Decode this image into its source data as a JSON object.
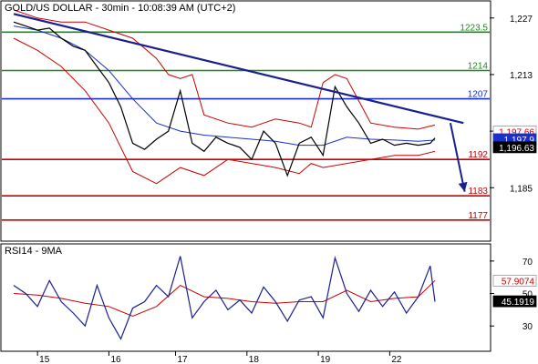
{
  "chart_data": {
    "type": "line",
    "title": "GOLD/US DOLLAR - 30min - 10:08:39 AM (UTC+2)",
    "colors": {
      "price": "#000000",
      "bollinger": "#cc0000",
      "moving_average": "#1a2fcc",
      "trendline": "#1a1f8f",
      "resistance": "#1b8c1b",
      "pivot": "#1a2fcc",
      "support": "#cc0000",
      "rsi": "#1a1f8f",
      "rsi_ma": "#cc0000"
    },
    "x_tick_labels": [
      "15",
      "16",
      "17",
      "18",
      "19",
      "22"
    ],
    "price_panel": {
      "y_ticks": [
        1227,
        1213,
        1199,
        1185
      ],
      "y_tick_labels": [
        "1,227",
        "1,213",
        "",
        "1,185"
      ],
      "ylim": [
        1172,
        1231
      ],
      "levels": [
        {
          "value": 1223.5,
          "label": "1223.5",
          "kind": "resistance"
        },
        {
          "value": 1214,
          "label": "1214",
          "kind": "resistance"
        },
        {
          "value": 1207,
          "label": "1207",
          "kind": "pivot"
        },
        {
          "value": 1192,
          "label": "1192",
          "kind": "support"
        },
        {
          "value": 1183,
          "label": "1183",
          "kind": "support"
        },
        {
          "value": 1177,
          "label": "1177",
          "kind": "support"
        }
      ],
      "price_boxes": [
        {
          "label": "1,197.66",
          "value": 1198.9,
          "style": "red-text"
        },
        {
          "label": "1,197.9",
          "value": 1197.0,
          "style": "blue-fill"
        },
        {
          "label": "1,196.63",
          "value": 1195.0,
          "style": "black-fill"
        }
      ],
      "trendline": {
        "x": [
          0.5,
          19.4
        ],
        "y": [
          1228,
          1201
        ]
      },
      "arrow": {
        "x": [
          18.85,
          19.45
        ],
        "y": [
          1201,
          1184
        ]
      },
      "close_series": {
        "x": [
          0.5,
          1,
          1.5,
          2,
          2.5,
          3,
          3.5,
          4,
          4.5,
          5,
          5.5,
          6,
          6.5,
          7,
          7.5,
          8,
          8.5,
          9,
          9.5,
          10,
          10.5,
          11,
          11.5,
          12,
          12.5,
          13,
          13.5,
          14,
          14.5,
          15,
          15.5,
          16,
          16.5,
          17,
          17.5,
          18,
          18.2
        ],
        "y": [
          1226,
          1225,
          1224,
          1224.5,
          1222,
          1220,
          1219,
          1215,
          1211,
          1205,
          1196,
          1194.5,
          1197,
          1199,
          1209,
          1196,
          1194,
          1197.5,
          1196,
          1195,
          1192,
          1199,
          1196,
          1188,
          1196,
          1197.5,
          1193,
          1210,
          1205,
          1201,
          1196,
          1197,
          1195.5,
          1196,
          1195.5,
          1196,
          1197.3
        ]
      },
      "ma_series": {
        "x": [
          0.5,
          1.5,
          2.5,
          3.5,
          4.5,
          5.5,
          6.5,
          7.5,
          8.5,
          9.5,
          10.5,
          11.5,
          12.5,
          13.5,
          14.5,
          15.5,
          16.5,
          17.5,
          18.2
        ],
        "y": [
          1225,
          1224,
          1222,
          1219,
          1214,
          1207,
          1201,
          1199,
          1198,
          1197.5,
          1197,
          1196.5,
          1195.5,
          1195.5,
          1197.5,
          1197,
          1196.8,
          1196.5,
          1196.8
        ]
      },
      "bollinger_upper": {
        "x": [
          0.5,
          1.5,
          2.5,
          3.5,
          4.5,
          5.5,
          6.5,
          7,
          7.5,
          8,
          8.5,
          9.5,
          10.5,
          11,
          11.5,
          12.5,
          13,
          13.5,
          14,
          14.5,
          15.5,
          16.5,
          17.5,
          18.2
        ],
        "y": [
          1229,
          1227,
          1226,
          1226,
          1224,
          1222,
          1217,
          1213,
          1212,
          1213,
          1203,
          1201,
          1200,
          1201,
          1202,
          1201,
          1200,
          1211,
          1213,
          1212,
          1201,
          1200,
          1199.5,
          1200.5
        ]
      },
      "bollinger_lower": {
        "x": [
          0.5,
          1.5,
          2.5,
          3.5,
          4.5,
          5.5,
          6.5,
          7.5,
          8.5,
          9.5,
          10.5,
          11.5,
          12.5,
          13,
          13.5,
          14.5,
          15.5,
          16.5,
          17.5,
          18.2
        ],
        "y": [
          1222,
          1219,
          1215,
          1209,
          1201,
          1189,
          1186,
          1190,
          1188,
          1192,
          1191,
          1190,
          1188.5,
          1191,
          1190,
          1191,
          1192,
          1193,
          1193,
          1194
        ]
      }
    },
    "rsi_panel": {
      "title": "RSI14 - 9MA",
      "ylim": [
        15,
        80
      ],
      "y_ticks": [
        70,
        50,
        30
      ],
      "y_tick_labels": [
        "70",
        "50",
        "30"
      ],
      "value_boxes": [
        {
          "label": "57.9074",
          "value": 57.9,
          "style": "red-text"
        },
        {
          "label": "45.1919",
          "value": 45.2,
          "style": "black-fill"
        }
      ],
      "rsi_series": {
        "x": [
          0.5,
          1,
          1.5,
          2,
          2.5,
          3,
          3.5,
          4,
          4.5,
          5,
          5.5,
          6,
          6.5,
          7,
          7.5,
          8,
          8.5,
          9,
          9.5,
          10,
          10.5,
          11,
          11.5,
          12,
          12.5,
          13,
          13.5,
          14,
          14.5,
          15,
          15.5,
          16,
          16.5,
          17,
          17.5,
          18,
          18.2
        ],
        "y": [
          55,
          50,
          42,
          58,
          45,
          38,
          30,
          55,
          35,
          22,
          41,
          45,
          55,
          48,
          73,
          35,
          45,
          52,
          40,
          46,
          38,
          54,
          45,
          33,
          46,
          48,
          35,
          72,
          50,
          39,
          52,
          42,
          51,
          38,
          48,
          67,
          45
        ]
      },
      "ma_series": {
        "x": [
          0.5,
          1.5,
          2.5,
          3.5,
          4.5,
          5.5,
          6.5,
          7.5,
          8.5,
          9.5,
          10.5,
          11.5,
          12.5,
          13.5,
          14.5,
          15.5,
          16.5,
          17.5,
          18.2
        ],
        "y": [
          50,
          49,
          47,
          44,
          42,
          36,
          42,
          55,
          48,
          47,
          45,
          44,
          45,
          45,
          52,
          45,
          47,
          48,
          58
        ]
      }
    }
  }
}
